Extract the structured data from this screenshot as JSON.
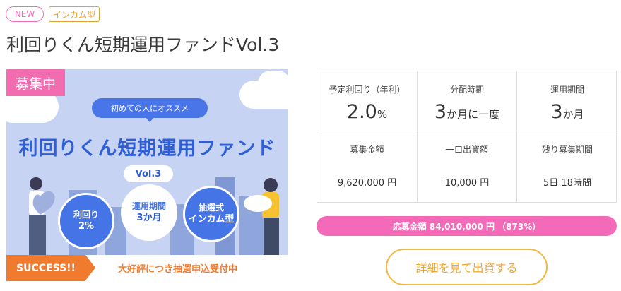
{
  "badges": {
    "new": "NEW",
    "type": "インカム型"
  },
  "title": "利回りくん短期運用ファンドVol.3",
  "banner": {
    "status": "募集中",
    "catch": "初めての人にオススメ",
    "title": "利回りくん短期運用ファンド",
    "vol": "Vol.3",
    "circles": [
      {
        "line1": "利回り",
        "line2": "2%"
      },
      {
        "line1": "運用期間",
        "line2": "3か月"
      },
      {
        "line1": "抽選式",
        "line2": "インカム型"
      }
    ],
    "success_label": "SUCCESS!!",
    "success_text": "大好評につき抽選申込受付中"
  },
  "info": {
    "yield": {
      "label": "予定利回り（年利）",
      "value": "2.0",
      "unit": "%"
    },
    "distribution": {
      "label": "分配時期",
      "value": "3",
      "unit": "か月に一度"
    },
    "period": {
      "label": "運用期間",
      "value": "3",
      "unit": "か月"
    },
    "amount": {
      "label": "募集金額",
      "value": "9,620,000 円"
    },
    "unit_price": {
      "label": "一口出資額",
      "value": "10,000 円"
    },
    "remaining": {
      "label": "残り募集期間",
      "value": "5日 18時間"
    }
  },
  "progress": {
    "text": "応募金額 84,010,000 円 （873%）",
    "fraction": 1.0
  },
  "cta": {
    "label": "詳細を見て出資する"
  },
  "colors": {
    "pink": "#f36ab8",
    "orange": "#f07a2e",
    "blue": "#4574e6",
    "gold": "#f5b83e"
  }
}
